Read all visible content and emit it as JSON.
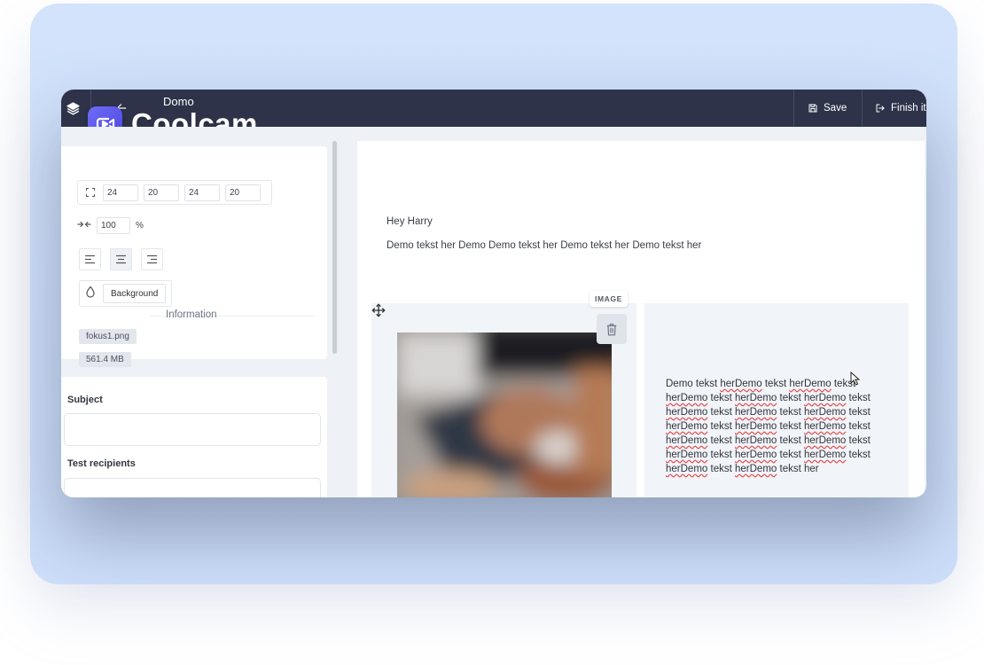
{
  "app": {
    "brand": "Coolcam",
    "document_title": "Domo"
  },
  "toolbar": {
    "save_label": "Save",
    "finish_label": "Finish it"
  },
  "layout_settings": {
    "padding": [
      "24",
      "20",
      "24",
      "20"
    ],
    "width_value": "100",
    "width_unit": "%",
    "alignment_selected": "center",
    "background_label": "Background"
  },
  "information": {
    "label": "Information",
    "file_name": "fokus1.png",
    "file_size": "561.4 MB"
  },
  "email": {
    "subject_label": "Subject",
    "subject_value": "",
    "recipients_label": "Test recipients",
    "recipients_value": ""
  },
  "content": {
    "greeting": "Hey Harry",
    "intro": "Demo tekst her Demo Demo tekst her Demo tekst her Demo tekst her",
    "image_badge": "IMAGE",
    "paragraph_lines": [
      [
        [
          "Demo tekst ",
          false
        ],
        [
          "herDemo",
          true
        ],
        [
          " tekst ",
          false
        ],
        [
          "herDemo",
          true
        ],
        [
          " tekst",
          false
        ]
      ],
      [
        [
          "herDemo",
          true
        ],
        [
          " tekst ",
          false
        ],
        [
          "herDemo",
          true
        ],
        [
          " tekst ",
          false
        ],
        [
          "herDemo",
          true
        ],
        [
          " tekst",
          false
        ]
      ],
      [
        [
          "herDemo",
          true
        ],
        [
          " tekst ",
          false
        ],
        [
          "herDemo",
          true
        ],
        [
          " tekst ",
          false
        ],
        [
          "herDemo",
          true
        ],
        [
          " tekst",
          false
        ]
      ],
      [
        [
          "herDemo",
          true
        ],
        [
          " tekst ",
          false
        ],
        [
          "herDemo",
          true
        ],
        [
          " tekst ",
          false
        ],
        [
          "herDemo",
          true
        ],
        [
          " tekst",
          false
        ]
      ],
      [
        [
          "herDemo",
          true
        ],
        [
          " tekst ",
          false
        ],
        [
          "herDemo",
          true
        ],
        [
          " tekst ",
          false
        ],
        [
          "herDemo",
          true
        ],
        [
          " tekst",
          false
        ]
      ],
      [
        [
          "herDemo",
          true
        ],
        [
          " tekst ",
          false
        ],
        [
          "herDemo",
          true
        ],
        [
          " tekst ",
          false
        ],
        [
          "herDemo",
          true
        ],
        [
          " tekst",
          false
        ]
      ],
      [
        [
          "herDemo",
          true
        ],
        [
          " tekst ",
          false
        ],
        [
          "herDemo",
          true
        ],
        [
          " tekst her",
          false
        ]
      ]
    ]
  },
  "colors": {
    "topbar": "#2e3349",
    "brand_accent": "#5a55ec",
    "backdrop": "#d2e3fb",
    "spellcheck": "#e34b4b"
  },
  "icons": [
    "layers-icon",
    "back-arrow-icon",
    "save-icon",
    "exit-icon",
    "padding-icon",
    "width-icon",
    "align-left-icon",
    "align-center-icon",
    "align-right-icon",
    "droplet-icon",
    "move-icon",
    "trash-icon",
    "cursor-icon"
  ]
}
